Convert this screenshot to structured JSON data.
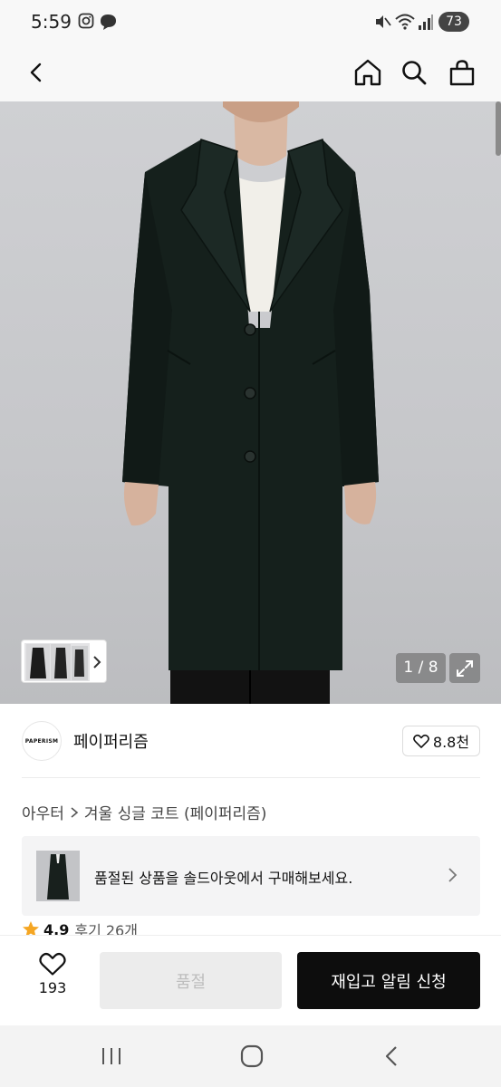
{
  "status_bar": {
    "time": "5:59",
    "battery": "73",
    "icons": [
      "instagram-icon",
      "messenger-icon",
      "mute-icon",
      "wifi-icon",
      "signal-icon"
    ]
  },
  "nav": {
    "icons": [
      "back-icon",
      "home-icon",
      "search-icon",
      "shopping-bag-icon"
    ]
  },
  "gallery": {
    "counter": "1 / 8",
    "icons": [
      "expand-icon",
      "chevron-right-icon"
    ]
  },
  "brand": {
    "logo_text": "PAPERISM",
    "name": "페이퍼리즘",
    "likes": "8.8천"
  },
  "breadcrumb": {
    "category": "아우터",
    "product_name": "겨울 싱글 코트 (페이퍼리즘)"
  },
  "soldout_banner": {
    "text": "품절된 상품을 솔드아웃에서 구매해보세요."
  },
  "rating": {
    "value": "4.9",
    "reviews": "후기 26개",
    "star_color": "#f5a623"
  },
  "actions": {
    "wish_count": "193",
    "soldout_label": "품절",
    "restock_label": "재입고 알림 신청"
  },
  "system_nav": {
    "icons": [
      "recent-apps-icon",
      "home-circle-icon",
      "back-triangle-icon"
    ]
  }
}
